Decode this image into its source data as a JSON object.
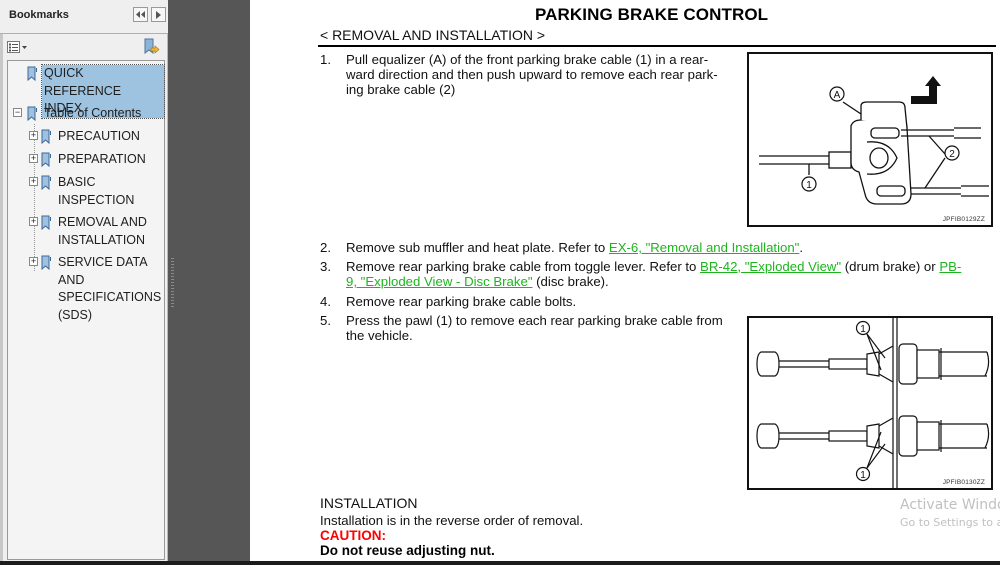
{
  "sidebar": {
    "title": "Bookmarks",
    "collapse_tooltip": "Collapse",
    "expand_tooltip": "Expand",
    "items": [
      {
        "label": "QUICK REFERENCE INDEX",
        "level": 0,
        "selected": true
      },
      {
        "label": "Table of Contents",
        "level": 0,
        "toggle": "−"
      },
      {
        "label": "PRECAUTION",
        "level": 1,
        "toggle": "+"
      },
      {
        "label": "PREPARATION",
        "level": 1,
        "toggle": "+"
      },
      {
        "label": "BASIC INSPECTION",
        "level": 1,
        "toggle": "+"
      },
      {
        "label": "REMOVAL AND INSTALLATION",
        "level": 1,
        "toggle": "+"
      },
      {
        "label": "SERVICE DATA AND SPECIFICATIONS (SDS)",
        "level": 1,
        "toggle": "+"
      }
    ],
    "item_lines": {
      "quick_ref": [
        "QUICK REFERENCE",
        "INDEX"
      ],
      "toc": [
        "Table of Contents"
      ],
      "precaution": [
        "PRECAUTION"
      ],
      "preparation": [
        "PREPARATION"
      ],
      "basic": [
        "BASIC",
        "INSPECTION"
      ],
      "removal": [
        "REMOVAL AND",
        "INSTALLATION"
      ],
      "service": [
        "SERVICE DATA",
        "AND",
        "SPECIFICATIONS",
        "(SDS)"
      ]
    }
  },
  "document": {
    "title": "PARKING BRAKE CONTROL",
    "breadcrumb": "< REMOVAL AND INSTALLATION >",
    "steps": [
      {
        "num": "1.",
        "lines": [
          "Pull equalizer (A) of the front parking brake cable (1) in a rear-",
          "ward direction and then push upward to remove each rear park-",
          "ing brake cable (2)"
        ]
      },
      {
        "num": "2.",
        "text_before": "Remove sub muffler and heat plate. Refer to ",
        "link": "EX-6, \"Removal and Installation\"",
        "text_after": "."
      },
      {
        "num": "3.",
        "text_before": "Remove rear parking brake cable from toggle lever. Refer to ",
        "link1": "BR-42, \"Exploded View\"",
        "text_mid": " (drum brake) or ",
        "link2_a": "PB-",
        "link2_b": "9, \"Exploded View - Disc Brake\"",
        "text_after": " (disc brake)."
      },
      {
        "num": "4.",
        "text": "Remove rear parking brake cable bolts."
      },
      {
        "num": "5.",
        "lines": [
          "Press the pawl (1) to remove each rear parking brake cable from",
          "the vehicle."
        ]
      }
    ],
    "figures": [
      {
        "id": "JPFIB0129ZZ",
        "callouts": [
          "A",
          "1",
          "2"
        ]
      },
      {
        "id": "JPFIB0130ZZ",
        "callouts": [
          "1",
          "1"
        ]
      }
    ],
    "installation": {
      "heading": "INSTALLATION",
      "text": "Installation is in the reverse order of removal.",
      "caution_label": "CAUTION:",
      "caution_text": "Do not reuse adjusting nut."
    }
  },
  "watermark": {
    "line1": "Activate Windows",
    "line2": "Go to Settings to activate Windows."
  },
  "colors": {
    "link": "#1db51d",
    "caution": "#ff0000",
    "selection": "#9dc3e0",
    "viewer_bg": "#565656"
  }
}
